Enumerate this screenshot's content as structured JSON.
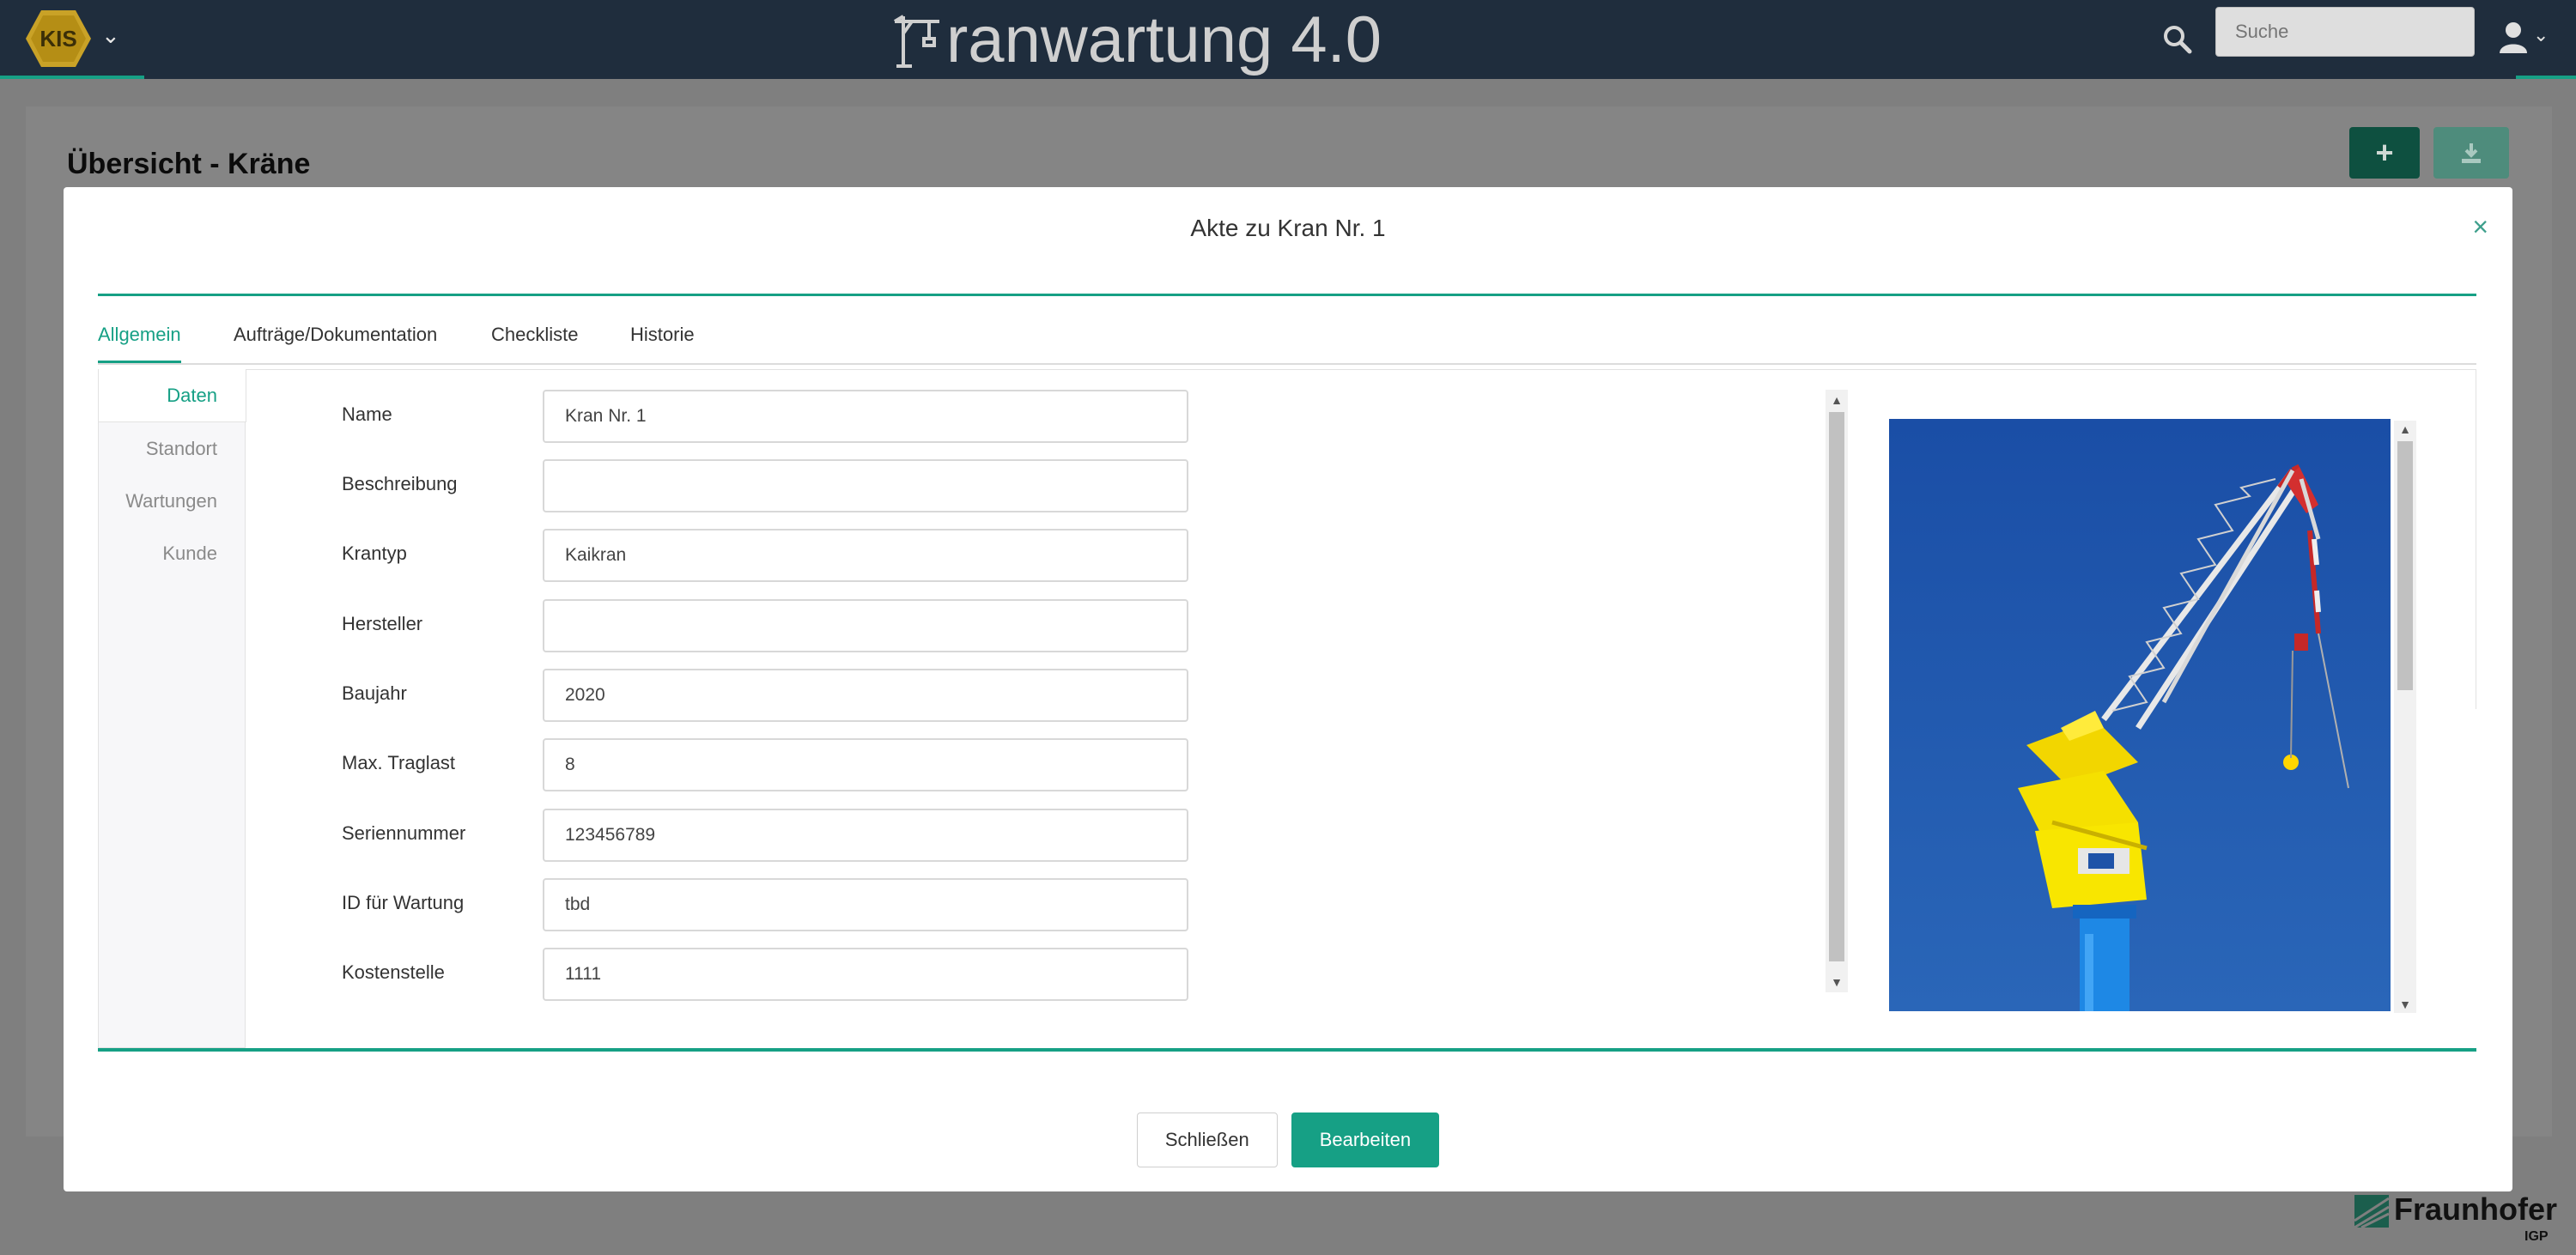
{
  "header": {
    "logo_text": "KIS",
    "title": "ranwartung 4.0",
    "search_placeholder": "Suche",
    "chevron": "⌄"
  },
  "page": {
    "title": "Übersicht - Kräne",
    "add_label": "+"
  },
  "modal": {
    "title": "Akte zu Kran Nr. 1",
    "close": "×",
    "tabs": [
      {
        "label": "Allgemein",
        "active": true
      },
      {
        "label": "Aufträge/Dokumentation",
        "active": false
      },
      {
        "label": "Checkliste",
        "active": false
      },
      {
        "label": "Historie",
        "active": false
      }
    ],
    "side_nav": [
      {
        "label": "Daten",
        "active": true
      },
      {
        "label": "Standort",
        "active": false
      },
      {
        "label": "Wartungen",
        "active": false
      },
      {
        "label": "Kunde",
        "active": false
      }
    ],
    "fields": [
      {
        "label": "Name",
        "value": "Kran Nr. 1"
      },
      {
        "label": "Beschreibung",
        "value": ""
      },
      {
        "label": "Krantyp",
        "value": "Kaikran"
      },
      {
        "label": "Hersteller",
        "value": ""
      },
      {
        "label": "Baujahr",
        "value": "2020"
      },
      {
        "label": "Max. Traglast",
        "value": "8"
      },
      {
        "label": "Seriennummer",
        "value": "123456789"
      },
      {
        "label": "ID für Wartung",
        "value": "tbd"
      },
      {
        "label": "Kostenstelle",
        "value": "1111"
      }
    ],
    "buttons": {
      "close_label": "Schließen",
      "edit_label": "Bearbeiten"
    }
  },
  "footer": {
    "brand": "Fraunhofer",
    "sub": "IGP"
  },
  "colors": {
    "accent": "#16a085",
    "nav_bg": "#1f2d3d",
    "sky": "#1f53a8"
  }
}
